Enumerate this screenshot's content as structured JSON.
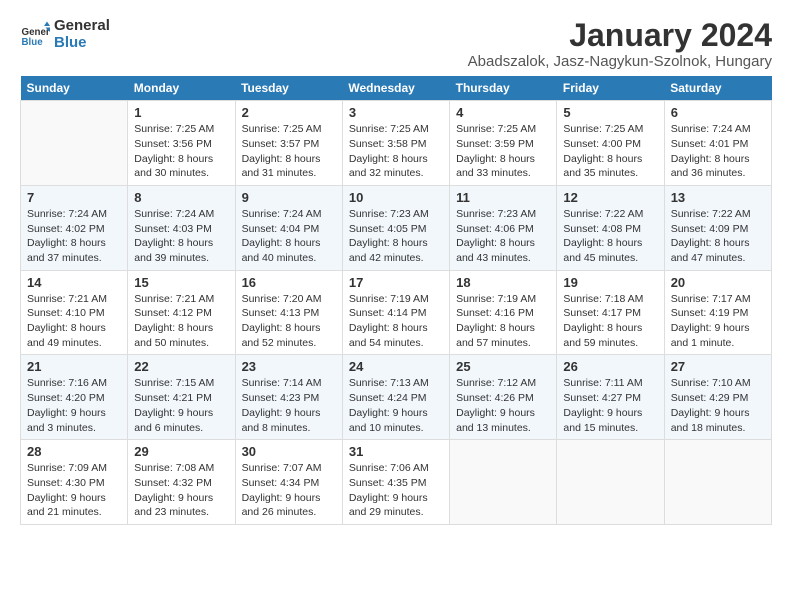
{
  "logo": {
    "general": "General",
    "blue": "Blue"
  },
  "title": "January 2024",
  "subtitle": "Abadszalok, Jasz-Nagykun-Szolnok, Hungary",
  "days_of_week": [
    "Sunday",
    "Monday",
    "Tuesday",
    "Wednesday",
    "Thursday",
    "Friday",
    "Saturday"
  ],
  "weeks": [
    [
      {
        "day": "",
        "info": ""
      },
      {
        "day": "1",
        "info": "Sunrise: 7:25 AM\nSunset: 3:56 PM\nDaylight: 8 hours\nand 30 minutes."
      },
      {
        "day": "2",
        "info": "Sunrise: 7:25 AM\nSunset: 3:57 PM\nDaylight: 8 hours\nand 31 minutes."
      },
      {
        "day": "3",
        "info": "Sunrise: 7:25 AM\nSunset: 3:58 PM\nDaylight: 8 hours\nand 32 minutes."
      },
      {
        "day": "4",
        "info": "Sunrise: 7:25 AM\nSunset: 3:59 PM\nDaylight: 8 hours\nand 33 minutes."
      },
      {
        "day": "5",
        "info": "Sunrise: 7:25 AM\nSunset: 4:00 PM\nDaylight: 8 hours\nand 35 minutes."
      },
      {
        "day": "6",
        "info": "Sunrise: 7:24 AM\nSunset: 4:01 PM\nDaylight: 8 hours\nand 36 minutes."
      }
    ],
    [
      {
        "day": "7",
        "info": "Sunrise: 7:24 AM\nSunset: 4:02 PM\nDaylight: 8 hours\nand 37 minutes."
      },
      {
        "day": "8",
        "info": "Sunrise: 7:24 AM\nSunset: 4:03 PM\nDaylight: 8 hours\nand 39 minutes."
      },
      {
        "day": "9",
        "info": "Sunrise: 7:24 AM\nSunset: 4:04 PM\nDaylight: 8 hours\nand 40 minutes."
      },
      {
        "day": "10",
        "info": "Sunrise: 7:23 AM\nSunset: 4:05 PM\nDaylight: 8 hours\nand 42 minutes."
      },
      {
        "day": "11",
        "info": "Sunrise: 7:23 AM\nSunset: 4:06 PM\nDaylight: 8 hours\nand 43 minutes."
      },
      {
        "day": "12",
        "info": "Sunrise: 7:22 AM\nSunset: 4:08 PM\nDaylight: 8 hours\nand 45 minutes."
      },
      {
        "day": "13",
        "info": "Sunrise: 7:22 AM\nSunset: 4:09 PM\nDaylight: 8 hours\nand 47 minutes."
      }
    ],
    [
      {
        "day": "14",
        "info": "Sunrise: 7:21 AM\nSunset: 4:10 PM\nDaylight: 8 hours\nand 49 minutes."
      },
      {
        "day": "15",
        "info": "Sunrise: 7:21 AM\nSunset: 4:12 PM\nDaylight: 8 hours\nand 50 minutes."
      },
      {
        "day": "16",
        "info": "Sunrise: 7:20 AM\nSunset: 4:13 PM\nDaylight: 8 hours\nand 52 minutes."
      },
      {
        "day": "17",
        "info": "Sunrise: 7:19 AM\nSunset: 4:14 PM\nDaylight: 8 hours\nand 54 minutes."
      },
      {
        "day": "18",
        "info": "Sunrise: 7:19 AM\nSunset: 4:16 PM\nDaylight: 8 hours\nand 57 minutes."
      },
      {
        "day": "19",
        "info": "Sunrise: 7:18 AM\nSunset: 4:17 PM\nDaylight: 8 hours\nand 59 minutes."
      },
      {
        "day": "20",
        "info": "Sunrise: 7:17 AM\nSunset: 4:19 PM\nDaylight: 9 hours\nand 1 minute."
      }
    ],
    [
      {
        "day": "21",
        "info": "Sunrise: 7:16 AM\nSunset: 4:20 PM\nDaylight: 9 hours\nand 3 minutes."
      },
      {
        "day": "22",
        "info": "Sunrise: 7:15 AM\nSunset: 4:21 PM\nDaylight: 9 hours\nand 6 minutes."
      },
      {
        "day": "23",
        "info": "Sunrise: 7:14 AM\nSunset: 4:23 PM\nDaylight: 9 hours\nand 8 minutes."
      },
      {
        "day": "24",
        "info": "Sunrise: 7:13 AM\nSunset: 4:24 PM\nDaylight: 9 hours\nand 10 minutes."
      },
      {
        "day": "25",
        "info": "Sunrise: 7:12 AM\nSunset: 4:26 PM\nDaylight: 9 hours\nand 13 minutes."
      },
      {
        "day": "26",
        "info": "Sunrise: 7:11 AM\nSunset: 4:27 PM\nDaylight: 9 hours\nand 15 minutes."
      },
      {
        "day": "27",
        "info": "Sunrise: 7:10 AM\nSunset: 4:29 PM\nDaylight: 9 hours\nand 18 minutes."
      }
    ],
    [
      {
        "day": "28",
        "info": "Sunrise: 7:09 AM\nSunset: 4:30 PM\nDaylight: 9 hours\nand 21 minutes."
      },
      {
        "day": "29",
        "info": "Sunrise: 7:08 AM\nSunset: 4:32 PM\nDaylight: 9 hours\nand 23 minutes."
      },
      {
        "day": "30",
        "info": "Sunrise: 7:07 AM\nSunset: 4:34 PM\nDaylight: 9 hours\nand 26 minutes."
      },
      {
        "day": "31",
        "info": "Sunrise: 7:06 AM\nSunset: 4:35 PM\nDaylight: 9 hours\nand 29 minutes."
      },
      {
        "day": "",
        "info": ""
      },
      {
        "day": "",
        "info": ""
      },
      {
        "day": "",
        "info": ""
      }
    ]
  ],
  "colors": {
    "header_bg": "#2a7ab5",
    "header_text": "#ffffff",
    "accent": "#2a7ab5"
  }
}
